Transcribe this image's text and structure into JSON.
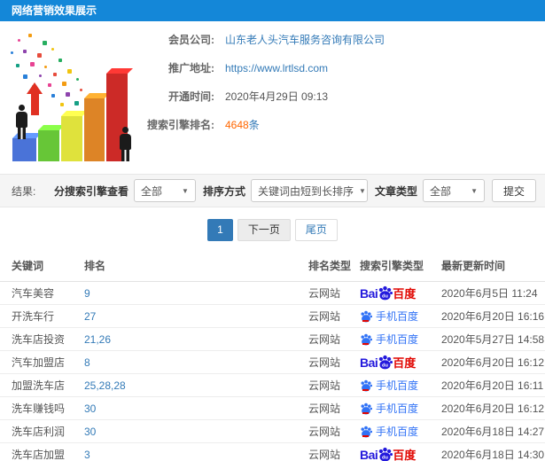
{
  "header": {
    "title": "网络营销效果展示"
  },
  "info": {
    "rows": [
      {
        "label": "会员公司:",
        "value": "山东老人头汽车服务咨询有限公司"
      },
      {
        "label": "推广地址:",
        "value": "https://www.lrtlsd.com"
      },
      {
        "label": "开通时间:",
        "value": "2020年4月29日 09:13"
      },
      {
        "label": "搜索引擎排名:",
        "value": "4648",
        "suffix": "条"
      }
    ]
  },
  "filters": {
    "result_label": "结果:",
    "engine_label": "分搜索引擎查看",
    "engine_value": "全部",
    "sort_label": "排序方式",
    "sort_value": "关键词由短到长排序",
    "article_label": "文章类型",
    "article_value": "全部",
    "submit_label": "提交"
  },
  "pagination": {
    "current": "1",
    "next": "下一页",
    "last": "尾页"
  },
  "table": {
    "headers": [
      "关键词",
      "排名",
      "排名类型",
      "搜索引擎类型",
      "最新更新时间"
    ],
    "rows": [
      {
        "keyword": "汽车美容",
        "rank": "9",
        "rank_type": "云网站",
        "engine": "baidu",
        "updated": "2020年6月5日 11:24"
      },
      {
        "keyword": "开洗车行",
        "rank": "27",
        "rank_type": "云网站",
        "engine": "mobile_baidu",
        "updated": "2020年6月20日 16:16"
      },
      {
        "keyword": "洗车店投资",
        "rank": "21,26",
        "rank_type": "云网站",
        "engine": "mobile_baidu",
        "updated": "2020年5月27日 14:58"
      },
      {
        "keyword": "汽车加盟店",
        "rank": "8",
        "rank_type": "云网站",
        "engine": "baidu",
        "updated": "2020年6月20日 16:12"
      },
      {
        "keyword": "加盟洗车店",
        "rank": "25,28,28",
        "rank_type": "云网站",
        "engine": "mobile_baidu",
        "updated": "2020年6月20日 16:11"
      },
      {
        "keyword": "洗车赚钱吗",
        "rank": "30",
        "rank_type": "云网站",
        "engine": "mobile_baidu",
        "updated": "2020年6月20日 16:12"
      },
      {
        "keyword": "洗车店利润",
        "rank": "30",
        "rank_type": "云网站",
        "engine": "mobile_baidu",
        "updated": "2020年6月18日 14:27"
      },
      {
        "keyword": "洗车店加盟",
        "rank": "3",
        "rank_type": "云网站",
        "engine": "baidu",
        "updated": "2020年6月18日 14:30"
      }
    ]
  },
  "engines": {
    "baidu": {
      "prefix": "Bai",
      "paw_text": "du",
      "suffix": "百度"
    },
    "mobile_baidu": {
      "label": "手机百度"
    }
  },
  "colors": {
    "header_bg": "#1487d8",
    "link_blue": "#337ab7",
    "rank_count_orange": "#ff6600",
    "baidu_blue": "#2319dc",
    "baidu_red": "#e10601",
    "mobile_baidu_blue": "#3072f6",
    "active_page_bg": "#337ab7",
    "filter_bar_bg": "#f5f5f5"
  }
}
